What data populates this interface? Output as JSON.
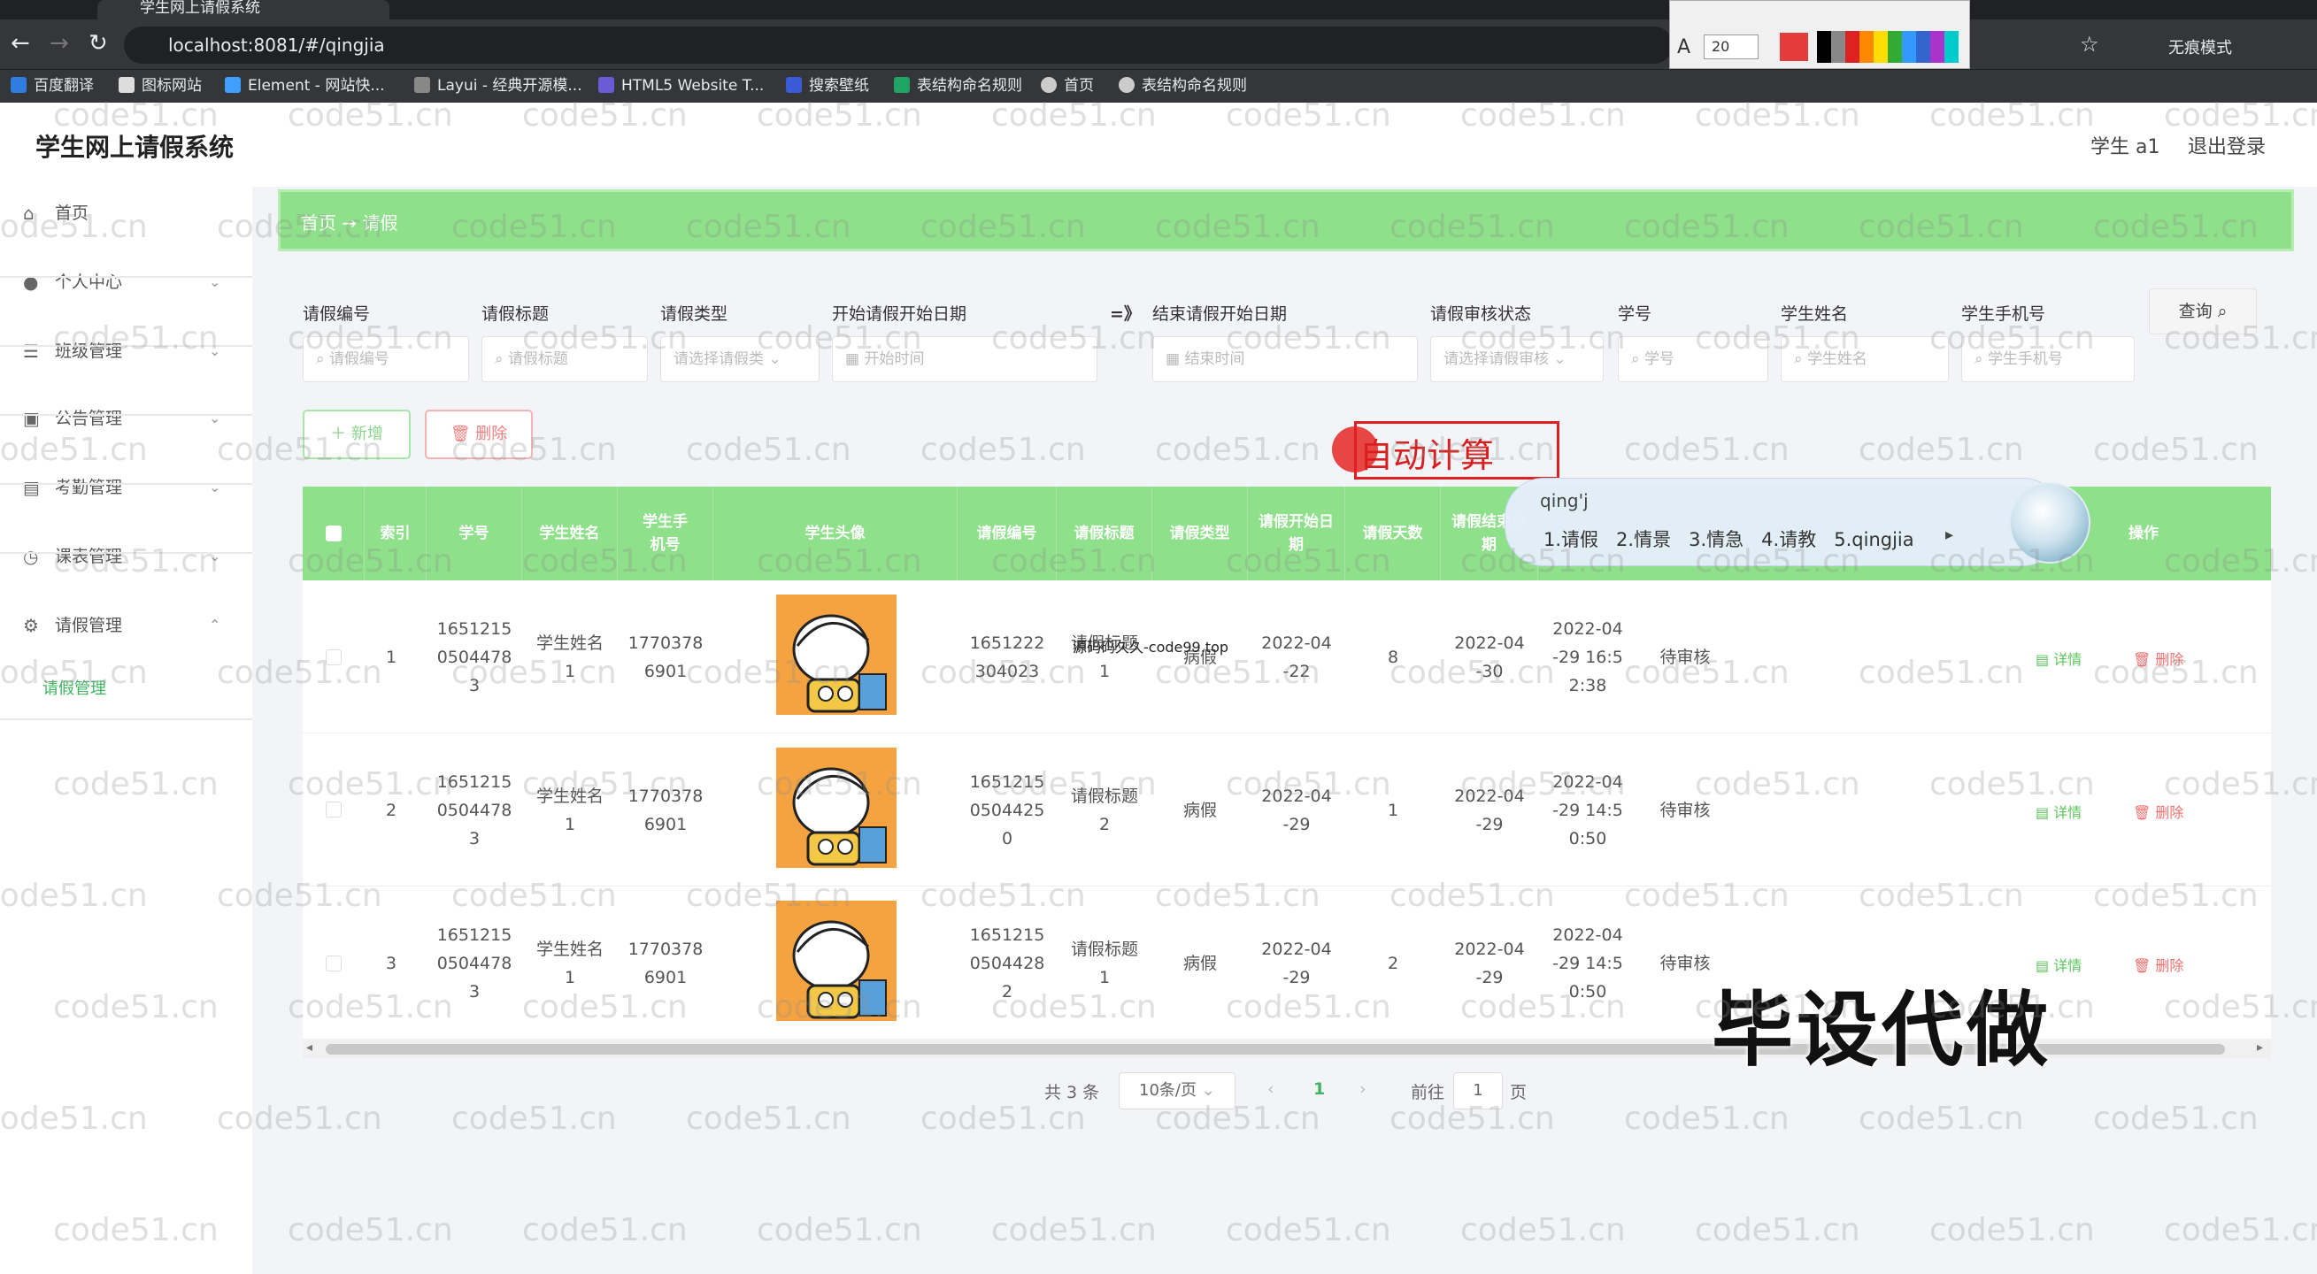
{
  "browser": {
    "tab_title": "学生网上请假系统",
    "url": "localhost:8081/#/qingjia",
    "incognito_label": "无痕模式",
    "bookmarks": [
      "百度翻译",
      "图标网站",
      "Element - 网站快...",
      "Layui - 经典开源模...",
      "HTML5 Website T...",
      "搜索壁纸",
      "表结构命名规则",
      "首页",
      "表结构命名规则"
    ],
    "annotation_font_size": "20"
  },
  "header": {
    "title": "学生网上请假系统",
    "user": "学生 a1",
    "logout": "退出登录"
  },
  "sidebar": {
    "items": [
      {
        "label": "首页",
        "icon": "home-icon"
      },
      {
        "label": "个人中心",
        "icon": "user-icon"
      },
      {
        "label": "班级管理",
        "icon": "menu-icon"
      },
      {
        "label": "公告管理",
        "icon": "notice-icon"
      },
      {
        "label": "考勤管理",
        "icon": "clipboard-icon"
      },
      {
        "label": "课表管理",
        "icon": "clock-icon"
      },
      {
        "label": "请假管理",
        "icon": "settings-icon"
      }
    ],
    "active_sub": "请假管理"
  },
  "breadcrumb": {
    "text": "首页 → 请假"
  },
  "filters": {
    "labels": [
      "请假编号",
      "请假标题",
      "请假类型",
      "开始请假开始日期",
      "结束请假开始日期",
      "请假审核状态",
      "学号",
      "学生姓名",
      "学生手机号"
    ],
    "range_sep": "=》",
    "placeholders": [
      "请假编号",
      "请假标题",
      "请选择请假类",
      "开始时间",
      "结束时间",
      "请选择请假审核",
      "学号",
      "学生姓名",
      "学生手机号"
    ],
    "query": "查询"
  },
  "actions": {
    "add": "新增",
    "delete": "删除"
  },
  "table": {
    "headers": [
      "索引",
      "学号",
      "学生姓名",
      "学生手机号",
      "学生头像",
      "请假编号",
      "请假标题",
      "请假类型",
      "请假开始日期",
      "请假天数",
      "请假结束日期",
      "",
      "操作"
    ],
    "rows": [
      {
        "index": "1",
        "student_no": "1651215\n0504478\n3",
        "name": "学生姓名\n1",
        "phone": "1770378\n6901",
        "leave_no": "1651222\n304023",
        "title": "请假标题\n1",
        "type": "病假",
        "start": "2022-04\n-22",
        "days": "8",
        "end": "2022-04\n-30",
        "created": "2022-04\n-29 16:5\n2:38",
        "status": "待审核"
      },
      {
        "index": "2",
        "student_no": "1651215\n0504478\n3",
        "name": "学生姓名\n1",
        "phone": "1770378\n6901",
        "leave_no": "1651215\n0504425\n0",
        "title": "请假标题\n2",
        "type": "病假",
        "start": "2022-04\n-29",
        "days": "1",
        "end": "2022-04\n-29",
        "created": "2022-04\n-29 14:5\n0:50",
        "status": "待审核"
      },
      {
        "index": "3",
        "student_no": "1651215\n0504478\n3",
        "name": "学生姓名\n1",
        "phone": "1770378\n6901",
        "leave_no": "1651215\n0504428\n2",
        "title": "请假标题\n1",
        "type": "病假",
        "start": "2022-04\n-29",
        "days": "2",
        "end": "2022-04\n-29",
        "created": "2022-04\n-29 14:5\n0:50",
        "status": "待审核"
      }
    ],
    "detail": "详情",
    "delete": "删除"
  },
  "pagination": {
    "total": "共 3 条",
    "size": "10条/页",
    "current": "1",
    "goto": "前往",
    "page_input": "1",
    "page_unit": "页"
  },
  "overlays": {
    "autocalc": "自动计算",
    "ime_composition": "qing'j",
    "ime_candidates": "1.请假   2.情景   3.情急   4.请教   5.qingjia",
    "promo": "毕设代做",
    "row_watermark": "源码码久久-code99.top",
    "watermark": "code51.cn"
  },
  "colors": {
    "accent": "#8ee08a",
    "brand_green": "#3fb45f",
    "danger": "#f07070"
  }
}
